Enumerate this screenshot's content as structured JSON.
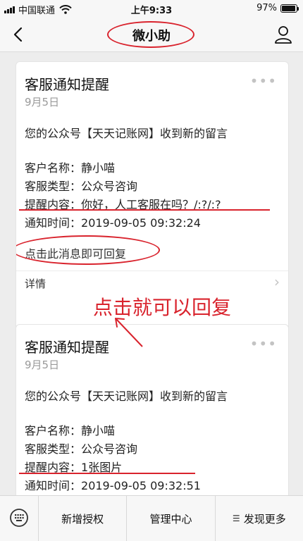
{
  "status_bar": {
    "carrier": "中国联通",
    "time": "上午9:33",
    "battery_text": "97%",
    "battery_level": 0.97
  },
  "nav": {
    "title": "微小助",
    "back_icon": "chevron-left-icon",
    "profile_icon": "person-icon"
  },
  "cards": [
    {
      "title": "客服通知提醒",
      "date": "9月5日",
      "intro": "您的公众号【天天记账网】收到新的留言",
      "fields": [
        {
          "key": "客户名称：",
          "value": "静小喵"
        },
        {
          "key": "客服类型：",
          "value": "公众号咨询"
        },
        {
          "key": "提醒内容：",
          "value": "你好，人工客服在吗？/:?/:?"
        },
        {
          "key": "通知时间：",
          "value": "2019-09-05 09:32:24"
        }
      ],
      "reply_hint": "点击此消息即可回复",
      "details_label": "详情"
    },
    {
      "title": "客服通知提醒",
      "date": "9月5日",
      "intro": "您的公众号【天天记账网】收到新的留言",
      "fields": [
        {
          "key": "客户名称：",
          "value": "静小喵"
        },
        {
          "key": "客服类型：",
          "value": "公众号咨询"
        },
        {
          "key": "提醒内容：",
          "value": "1张图片"
        },
        {
          "key": "通知时间：",
          "value": "2019-09-05 09:32:51"
        }
      ]
    }
  ],
  "annotation": "点击就可以回复",
  "bottom_menu": {
    "items": [
      "新增授权",
      "管理中心",
      "发现更多"
    ],
    "keyboard_icon": "keyboard-icon",
    "hamburger_icon": "menu-icon"
  },
  "colors": {
    "annotation_red": "#d9232d",
    "background": "#ededed"
  }
}
